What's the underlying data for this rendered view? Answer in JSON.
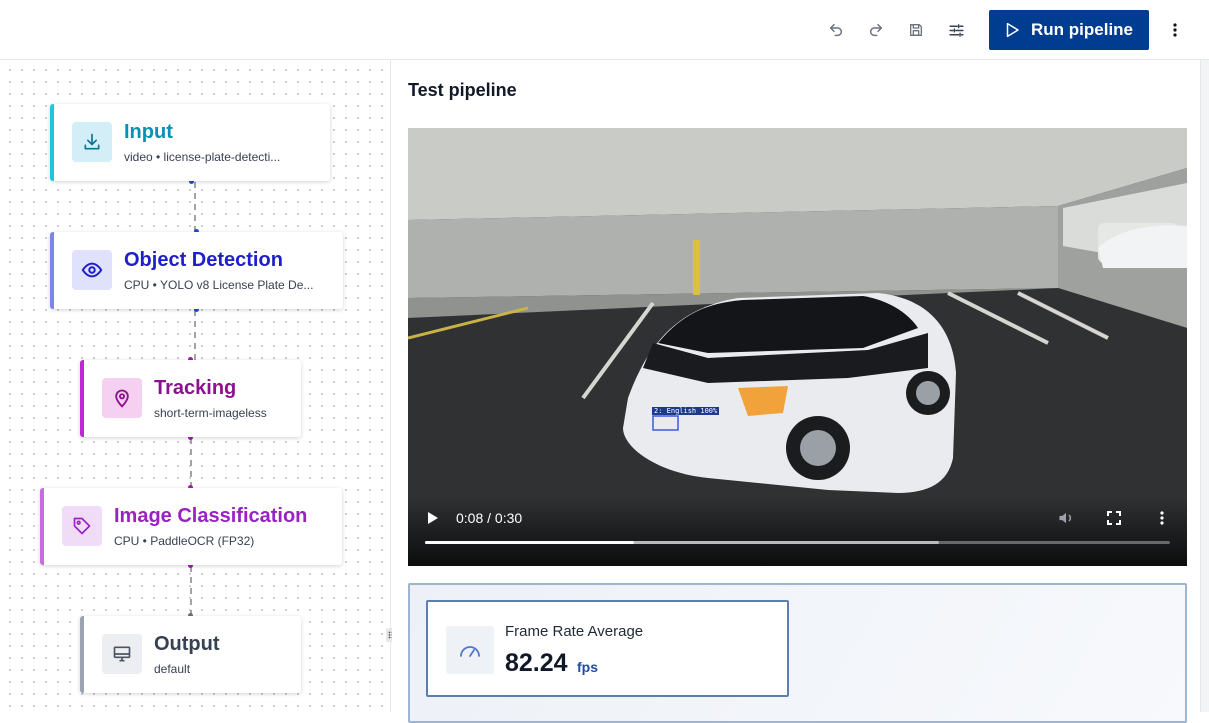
{
  "toolbar": {
    "undo_icon": "undo-icon",
    "redo_icon": "redo-icon",
    "save_icon": "save-icon",
    "settings_icon": "sliders-icon",
    "run_label": "Run pipeline",
    "more_icon": "more-vertical-icon"
  },
  "pipeline": {
    "nodes": [
      {
        "title": "Input",
        "subtitle": "video • license-plate-detecti...",
        "icon": "download-icon",
        "accent": "#22c3dd",
        "title_color": "#0891b2"
      },
      {
        "title": "Object Detection",
        "subtitle": "CPU • YOLO v8 License Plate De...",
        "icon": "eye-icon",
        "accent": "#7c86e6",
        "title_color": "#1e1fc8"
      },
      {
        "title": "Tracking",
        "subtitle": "short-term-imageless",
        "icon": "location-pin-icon",
        "accent": "#c026d3",
        "title_color": "#8b128f"
      },
      {
        "title": "Image Classification",
        "subtitle": "CPU • PaddleOCR (FP32)",
        "icon": "tag-icon",
        "accent": "#c86be3",
        "title_color": "#9a22c4"
      },
      {
        "title": "Output",
        "subtitle": "default",
        "icon": "monitor-icon",
        "accent": "#9ca3af",
        "title_color": "#374151"
      }
    ]
  },
  "panel": {
    "title": "Test pipeline",
    "video": {
      "time": "0:08 / 0:30",
      "progress_fraction": 0.28,
      "buffered_fraction": 0.69,
      "detection_label": "2: English 100%"
    },
    "metric": {
      "label": "Frame Rate Average",
      "value": "82.24",
      "unit": "fps",
      "icon": "gauge-icon"
    }
  }
}
